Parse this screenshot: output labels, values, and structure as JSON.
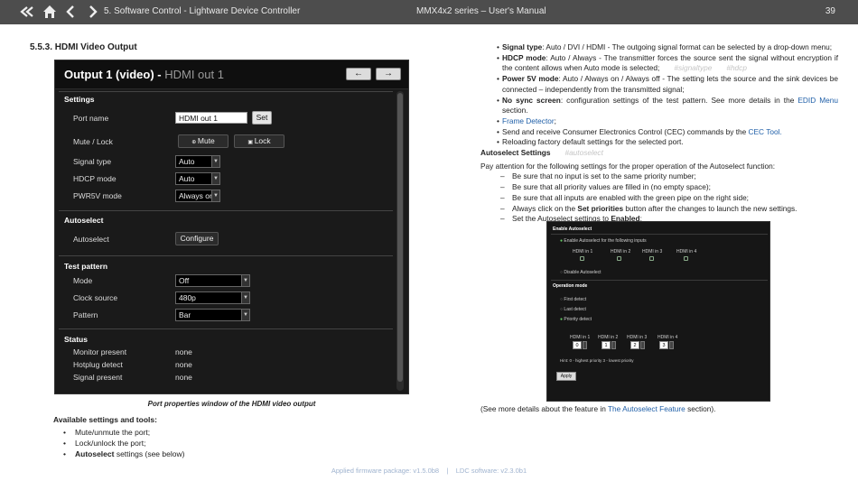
{
  "topbar": {
    "crumb": "5. Software Control - Lightware Device Controller",
    "doc_title": "MMX4x2 series – User's Manual",
    "page": "39",
    "icons": [
      "double-back-icon",
      "home-icon",
      "prev-icon",
      "next-icon"
    ]
  },
  "section_title": "5.5.3. HDMI Video Output",
  "window": {
    "title": "Output 1 (video) - ",
    "subtitle": "HDMI out 1",
    "nav_prev": "←",
    "nav_next": "→",
    "settings_h": "Settings",
    "port_name_label": "Port name",
    "port_name_value": "HDMI out 1",
    "set_btn": "Set",
    "mute_lock_label": "Mute / Lock",
    "mute_btn": "Mute",
    "lock_btn": "Lock",
    "signal_type_label": "Signal type",
    "signal_type_value": "Auto",
    "hdcp_label": "HDCP mode",
    "hdcp_value": "Auto",
    "pwr5v_label": "PWR5V mode",
    "pwr5v_value": "Always on",
    "autoselect_h": "Autoselect",
    "autoselect_label": "Autoselect",
    "configure_btn": "Configure",
    "testpattern_h": "Test pattern",
    "mode_label": "Mode",
    "mode_value": "Off",
    "clock_label": "Clock source",
    "clock_value": "480p",
    "pattern_label": "Pattern",
    "pattern_value": "Bar",
    "status_h": "Status",
    "monitor_label": "Monitor present",
    "monitor_value": "none",
    "hotplug_label": "Hotplug detect",
    "hotplug_value": "none",
    "signal_present_label": "Signal present",
    "signal_present_value": "none"
  },
  "caption": "Port properties window of the HDMI video output",
  "available_heading": "Available settings and tools:",
  "available": [
    {
      "text": "Mute/unmute the port;"
    },
    {
      "text": "Lock/unlock the port;"
    },
    {
      "bold": "Autoselect",
      "text": " settings (see below)"
    }
  ],
  "right": {
    "b1_term": "Signal type",
    "b1_text": ": Auto / DVI / HDMI - The outgoing signal format can be selected by a drop-down menu;",
    "b2_term": "HDCP mode",
    "b2_text": ": Auto / Always - The transmitter forces the source sent the signal without encryption if the content allows when Auto mode is selected;",
    "b2_tag1": "#signaltype",
    "b2_tag2": "#hdcp",
    "b3_term": "Power 5V mode",
    "b3_text": ": Auto / Always on / Always off - The setting lets the source and the sink devices be connected – independently from the transmitted signal;",
    "b4_term": "No sync screen",
    "b4_text": ": configuration settings of the test pattern. See more details in the ",
    "b4_link": "EDID Menu",
    "b4_end": " section.",
    "b5_link": "Frame Detector",
    "b5_end": ";",
    "b6_text": "Send and receive Consumer Electronics Control (CEC) commands by the ",
    "b6_link": "CEC Tool",
    "b6_end": ".",
    "b7_text": "Reloading factory default settings for the selected port.",
    "as_heading": "Autoselect Settings",
    "as_tag": "#autoselect",
    "attention": "Pay attention for the following settings for the proper operation of the Autoselect function:",
    "d1": "Be sure that no input is set to the same priority number;",
    "d2": "Be sure that all priority values are filled in (no empty space);",
    "d3": "Be sure that all inputs are enabled with the green pipe on the right side;",
    "d4_a": "Always click on the ",
    "d4_b": "Set priorities",
    "d4_c": " button after the changes to launch the new settings.",
    "d5_a": "Set the Autoselect settings to ",
    "d5_b": "Enabled",
    "d5_c": ";"
  },
  "autoselect_panel": {
    "title": "Enable Autoselect",
    "enable_label": "Enable Autoselect for the following inputs",
    "inputs": [
      "HDMI in 1",
      "HDMI in 2",
      "HDMI in 3",
      "HDMI in 4"
    ],
    "disable_label": "Disable Autoselect",
    "op_mode": "Operation mode",
    "first": "First detect",
    "last": "Last detect",
    "priority": "Priority detect",
    "priorities": [
      "0",
      "1",
      "2",
      "3"
    ],
    "hint": "Hint: 0 - highest priority 3 - lowest priority",
    "apply": "Apply"
  },
  "seemore_a": "(See more details about the feature in ",
  "seemore_link": "The Autoselect Feature",
  "seemore_b": " section).",
  "footer_a": "Applied firmware package: v1.5.0b8",
  "footer_sep": "|",
  "footer_b": "LDC software: v2.3.0b1"
}
